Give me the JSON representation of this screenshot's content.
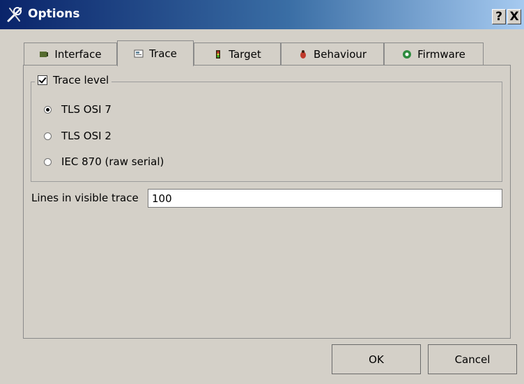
{
  "window": {
    "title": "Options",
    "help_label": "?",
    "close_label": "X"
  },
  "tabs": [
    {
      "label": "Interface",
      "icon": "interface-icon",
      "color": "#556b2f"
    },
    {
      "label": "Trace",
      "icon": "trace-icon",
      "color": "#6a8ca0"
    },
    {
      "label": "Target",
      "icon": "target-icon",
      "color": "#8b5a2b"
    },
    {
      "label": "Behaviour",
      "icon": "behaviour-icon",
      "color": "#c0392b"
    },
    {
      "label": "Firmware",
      "icon": "firmware-icon",
      "color": "#2e8b3e"
    }
  ],
  "active_tab": "Trace",
  "trace": {
    "group_label": "Trace level",
    "group_checked": true,
    "options": [
      {
        "label": "TLS OSI 7",
        "selected": true
      },
      {
        "label": "TLS OSI 2",
        "selected": false
      },
      {
        "label": "IEC 870 (raw serial)",
        "selected": false
      }
    ],
    "lines_label": "Lines in visible trace",
    "lines_value": "100"
  },
  "buttons": {
    "ok": "OK",
    "cancel": "Cancel"
  }
}
